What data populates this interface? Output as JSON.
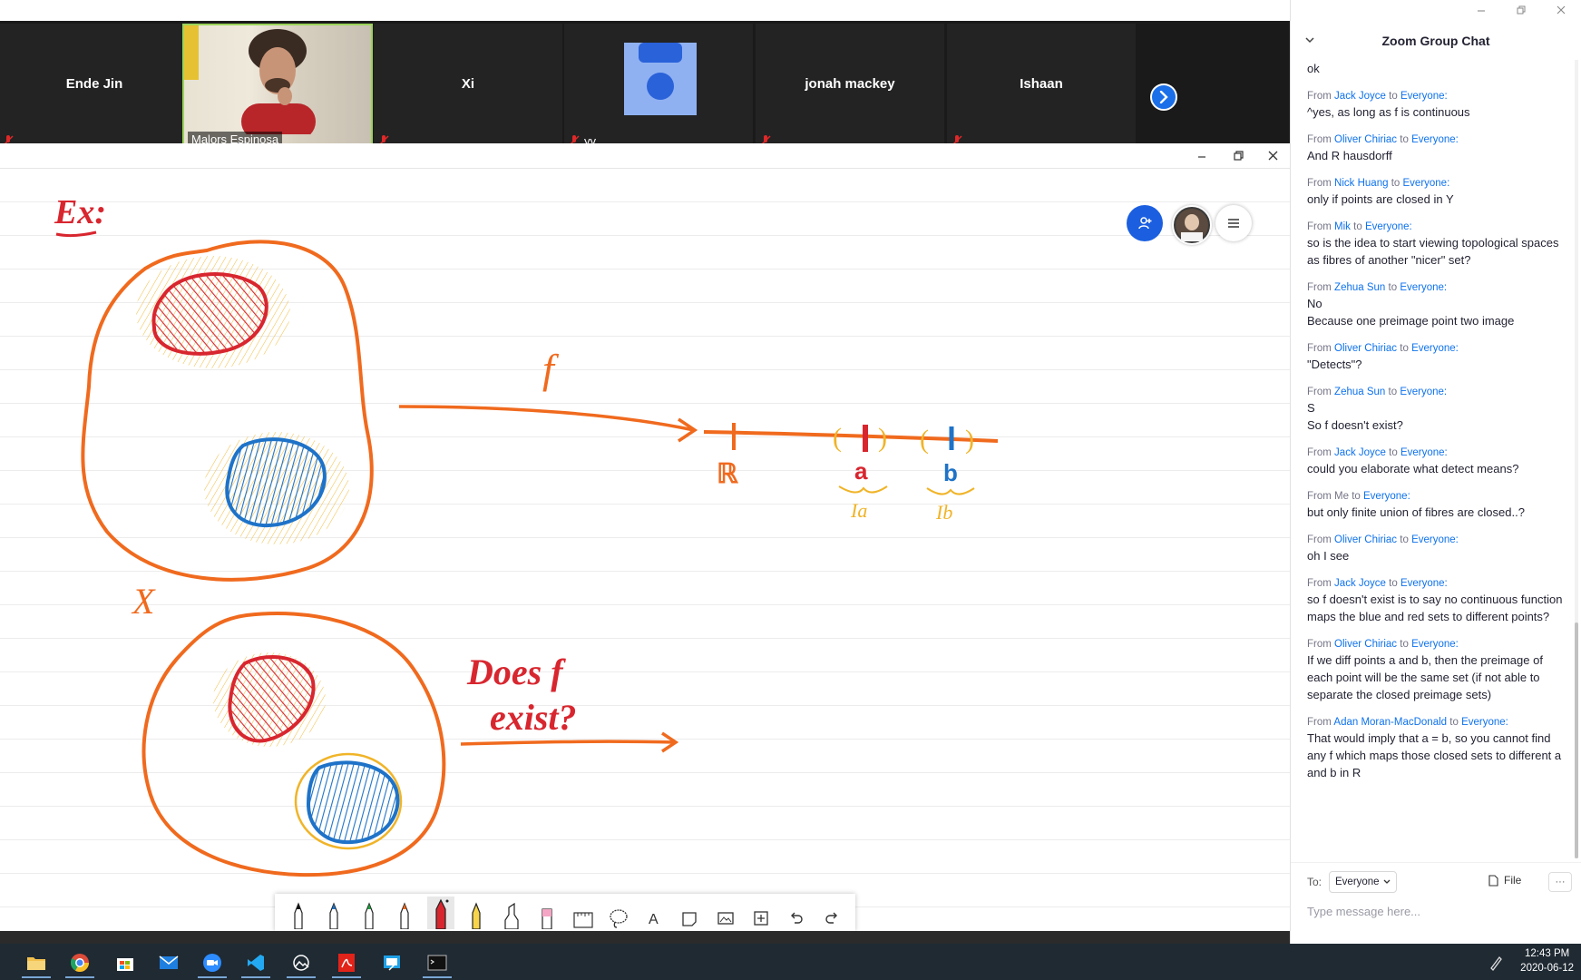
{
  "participants": [
    {
      "name": "Ende Jin",
      "muted": true
    },
    {
      "name": "Malors Espinosa",
      "muted": true,
      "video": true
    },
    {
      "name": "Xi",
      "muted": true
    },
    {
      "name": "yy",
      "muted": true,
      "avatar": true
    },
    {
      "name": "jonah mackey",
      "muted": true
    },
    {
      "name": "Ishaan",
      "muted": true
    }
  ],
  "whiteboard": {
    "drawing": {
      "ex_label": "Ex:",
      "f_label": "f",
      "R_label": "ℝ",
      "a_label": "a",
      "b_label": "b",
      "Ia_label": "Ia",
      "Ib_label": "Ib",
      "X_label": "X",
      "question_line1": "Does f",
      "question_line2": "exist?"
    },
    "colors": {
      "orange": "#f06a1e",
      "red": "#d8262f",
      "blue": "#1e73c8",
      "yellow": "#f0b428"
    },
    "toolbar_icons": [
      "pen-black",
      "pen-blue",
      "pen-green",
      "pen-orange",
      "pen-red",
      "pencil-yellow",
      "highlighter",
      "eraser",
      "ruler",
      "lasso",
      "text",
      "sticky-note",
      "image",
      "add-page",
      "undo",
      "redo"
    ]
  },
  "chat": {
    "title": "Zoom Group Chat",
    "first_message": "ok",
    "messages": [
      {
        "from_prefix": "From",
        "from": "Jack Joyce",
        "to_word": "to",
        "to": "Everyone:",
        "lines": [
          "^yes, as long as f is continuous"
        ]
      },
      {
        "from_prefix": "From",
        "from": "Oliver Chiriac",
        "to_word": "to",
        "to": "Everyone:",
        "lines": [
          "And R hausdorff"
        ]
      },
      {
        "from_prefix": "From",
        "from": "Nick Huang",
        "to_word": "to",
        "to": "Everyone:",
        "lines": [
          "only if points are closed in Y"
        ]
      },
      {
        "from_prefix": "From",
        "from": "Mik",
        "to_word": "to",
        "to": "Everyone:",
        "lines": [
          "so is the idea to start viewing topological spaces as fibres of another \"nicer\" set?"
        ]
      },
      {
        "from_prefix": "From",
        "from": "Zehua Sun",
        "to_word": "to",
        "to": "Everyone:",
        "lines": [
          "No",
          "Because one preimage point two image"
        ]
      },
      {
        "from_prefix": "From",
        "from": "Oliver Chiriac",
        "to_word": "to",
        "to": "Everyone:",
        "lines": [
          "\"Detects\"?"
        ]
      },
      {
        "from_prefix": "From",
        "from": "Zehua Sun",
        "to_word": "to",
        "to": "Everyone:",
        "lines": [
          "S",
          "So f doesn't exist?"
        ]
      },
      {
        "from_prefix": "From",
        "from": "Jack Joyce",
        "to_word": "to",
        "to": "Everyone:",
        "lines": [
          "could you elaborate what detect means?"
        ]
      },
      {
        "from_prefix": "From Me",
        "from": "",
        "to_word": "to",
        "to": "Everyone:",
        "lines": [
          "but only finite union of fibres are closed..?"
        ],
        "is_me": true
      },
      {
        "from_prefix": "From",
        "from": "Oliver Chiriac",
        "to_word": "to",
        "to": "Everyone:",
        "lines": [
          "oh I see"
        ]
      },
      {
        "from_prefix": "From",
        "from": "Jack Joyce",
        "to_word": "to",
        "to": "Everyone:",
        "lines": [
          "so f doesn't exist is to say no continuous function maps the blue and red sets to different points?"
        ]
      },
      {
        "from_prefix": "From",
        "from": "Oliver Chiriac",
        "to_word": "to",
        "to": "Everyone:",
        "lines": [
          "If we diff points a and b, then the preimage of each point will be the same set (if not able to separate the closed preimage sets)"
        ]
      },
      {
        "from_prefix": "From",
        "from": "Adan Moran-MacDonald",
        "to_word": "to",
        "to": "Everyone:",
        "lines": [
          "That would imply that a = b, so you cannot find any f which maps those closed sets to different a and b in R"
        ]
      }
    ],
    "footer": {
      "to_label": "To:",
      "recipient": "Everyone",
      "file_label": "File",
      "more_label": "···",
      "input_placeholder": "Type message here..."
    }
  },
  "taskbar": {
    "apps": [
      "file-explorer",
      "chrome",
      "store",
      "mail",
      "zoom",
      "vscode",
      "photos",
      "acrobat",
      "snip",
      "terminal"
    ],
    "time": "12:43 PM",
    "date": "2020-06-12"
  }
}
